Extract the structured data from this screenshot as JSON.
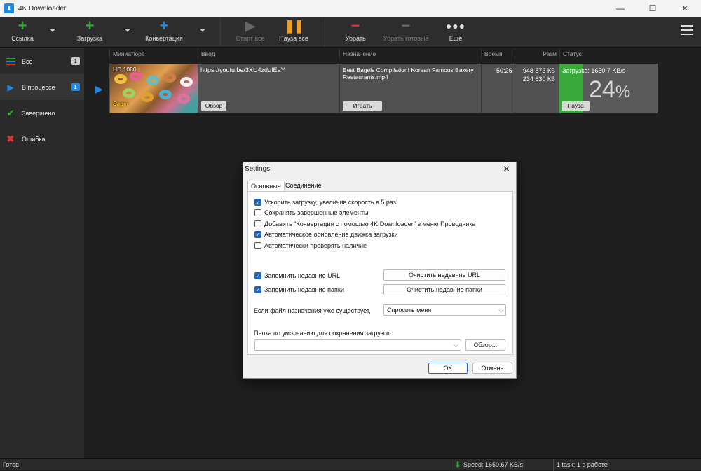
{
  "window": {
    "title": "4K Downloader",
    "controls": [
      "—",
      "☐",
      "✕"
    ]
  },
  "toolbar": {
    "link_label": "Ссылка",
    "download_label": "Загрузка",
    "convert_label": "Конвертация",
    "start_all_label": "Старт все",
    "pause_all_label": "Пауза все",
    "remove_label": "Убрать",
    "remove_done_label": "Убрать готовые",
    "more_label": "Ещё"
  },
  "sidebar": {
    "items": [
      {
        "label": "Все",
        "badge": "1",
        "icon": "list-icon"
      },
      {
        "label": "В процессе",
        "badge": "1",
        "icon": "play-icon"
      },
      {
        "label": "Завершено",
        "badge": "",
        "icon": "check-icon"
      },
      {
        "label": "Ошибка",
        "badge": "",
        "icon": "error-icon"
      }
    ]
  },
  "table": {
    "headers": [
      "Миниатюра",
      "Ввод",
      "Назначение",
      "Время",
      "Разм",
      "Статус"
    ],
    "row": {
      "quality": "HD 1080",
      "thumb_logo": "Bagel",
      "input_url": "https://youtu.be/3XU4zdofEaY",
      "browse_label": "Обзор",
      "destination": "Best Bagels Compilation! Korean Famous Bakery Restaurants.mp4",
      "play_label": "Играть",
      "time": "50:26",
      "size_total": "948 873 КБ",
      "size_done": "234 630 КБ",
      "status_text": "Загрузка: 1650.7 KB/s",
      "percent": "24",
      "percent_sign": "%",
      "progress": 0.24,
      "pause_label": "Пауза"
    }
  },
  "statusbar": {
    "ready": "Готов",
    "speed": "Speed: 1650.67 KB/s",
    "tasks": "1 task: 1 в работе"
  },
  "dialog": {
    "title": "Settings",
    "tabs": [
      "Основные",
      "Соединение"
    ],
    "checkboxes": [
      {
        "label": "Ускорить загрузку, увеличив скорость в 5 раз!",
        "checked": true
      },
      {
        "label": "Сохранять завершенные элементы",
        "checked": false
      },
      {
        "label": "Добавить \"Конвертация с помощью 4K Downloader\" в меню Проводника",
        "checked": false
      },
      {
        "label": "Автоматическое обновление движка загрузки",
        "checked": true
      },
      {
        "label": "Автоматически проверять наличие",
        "checked": false
      }
    ],
    "remember_urls_label": "Запомнить недавние URL",
    "remember_folders_label": "Запомнить недавние папки",
    "clear_urls_label": "Очистить недавние URL",
    "clear_folders_label": "Очистить недавние папки",
    "exists_label": "Если файл назначения уже существует,",
    "exists_value": "Спросить меня",
    "folder_label": "Папка по умолчанию для сохранения загрузок:",
    "folder_value": "",
    "browse_label": "Обзор...",
    "ok_label": "OK",
    "cancel_label": "Отмена"
  },
  "colors": {
    "accent_green": "#2fa82f",
    "accent_blue": "#1e88e5",
    "accent_orange": "#f0a020",
    "accent_red": "#e03030",
    "progress_green": "#3aa83a"
  }
}
